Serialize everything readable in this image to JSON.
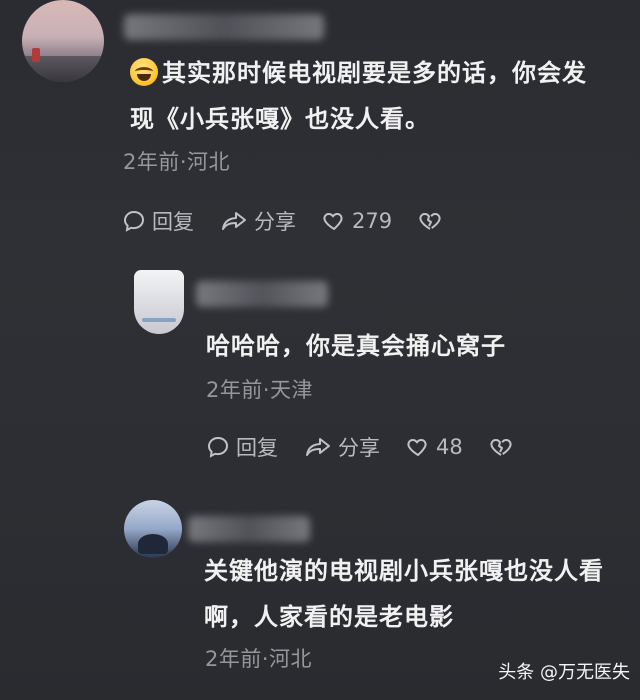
{
  "comments": [
    {
      "text": "其实那时候电视剧要是多的话，你会发现《小兵张嘎》也没人看。",
      "meta": "2年前·河北",
      "actions": {
        "reply": "回复",
        "share": "分享",
        "likes": "279"
      }
    },
    {
      "text": "哈哈哈，你是真会捅心窝子",
      "meta": "2年前·天津",
      "actions": {
        "reply": "回复",
        "share": "分享",
        "likes": "48"
      }
    },
    {
      "text": "关键他演的电视剧小兵张嘎也没人看啊，人家看的是老电影",
      "meta": "2年前·河北"
    }
  ],
  "watermark": "头条 @万无医失",
  "icons": {
    "reply": "comment-bubble-icon",
    "share": "share-arrow-icon",
    "like": "heart-icon",
    "dislike": "broken-heart-icon",
    "emoji": "laughing-crying-emoji-icon"
  }
}
